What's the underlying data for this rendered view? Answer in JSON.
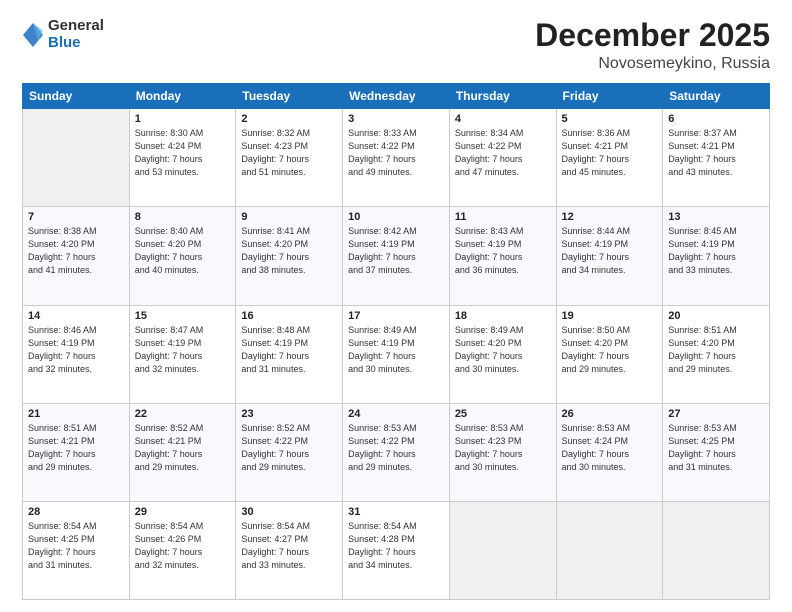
{
  "logo": {
    "general": "General",
    "blue": "Blue"
  },
  "header": {
    "title": "December 2025",
    "subtitle": "Novosemeykino, Russia"
  },
  "days_of_week": [
    "Sunday",
    "Monday",
    "Tuesday",
    "Wednesday",
    "Thursday",
    "Friday",
    "Saturday"
  ],
  "weeks": [
    [
      {
        "day": "",
        "info": ""
      },
      {
        "day": "1",
        "info": "Sunrise: 8:30 AM\nSunset: 4:24 PM\nDaylight: 7 hours\nand 53 minutes."
      },
      {
        "day": "2",
        "info": "Sunrise: 8:32 AM\nSunset: 4:23 PM\nDaylight: 7 hours\nand 51 minutes."
      },
      {
        "day": "3",
        "info": "Sunrise: 8:33 AM\nSunset: 4:22 PM\nDaylight: 7 hours\nand 49 minutes."
      },
      {
        "day": "4",
        "info": "Sunrise: 8:34 AM\nSunset: 4:22 PM\nDaylight: 7 hours\nand 47 minutes."
      },
      {
        "day": "5",
        "info": "Sunrise: 8:36 AM\nSunset: 4:21 PM\nDaylight: 7 hours\nand 45 minutes."
      },
      {
        "day": "6",
        "info": "Sunrise: 8:37 AM\nSunset: 4:21 PM\nDaylight: 7 hours\nand 43 minutes."
      }
    ],
    [
      {
        "day": "7",
        "info": "Sunrise: 8:38 AM\nSunset: 4:20 PM\nDaylight: 7 hours\nand 41 minutes."
      },
      {
        "day": "8",
        "info": "Sunrise: 8:40 AM\nSunset: 4:20 PM\nDaylight: 7 hours\nand 40 minutes."
      },
      {
        "day": "9",
        "info": "Sunrise: 8:41 AM\nSunset: 4:20 PM\nDaylight: 7 hours\nand 38 minutes."
      },
      {
        "day": "10",
        "info": "Sunrise: 8:42 AM\nSunset: 4:19 PM\nDaylight: 7 hours\nand 37 minutes."
      },
      {
        "day": "11",
        "info": "Sunrise: 8:43 AM\nSunset: 4:19 PM\nDaylight: 7 hours\nand 36 minutes."
      },
      {
        "day": "12",
        "info": "Sunrise: 8:44 AM\nSunset: 4:19 PM\nDaylight: 7 hours\nand 34 minutes."
      },
      {
        "day": "13",
        "info": "Sunrise: 8:45 AM\nSunset: 4:19 PM\nDaylight: 7 hours\nand 33 minutes."
      }
    ],
    [
      {
        "day": "14",
        "info": "Sunrise: 8:46 AM\nSunset: 4:19 PM\nDaylight: 7 hours\nand 32 minutes."
      },
      {
        "day": "15",
        "info": "Sunrise: 8:47 AM\nSunset: 4:19 PM\nDaylight: 7 hours\nand 32 minutes."
      },
      {
        "day": "16",
        "info": "Sunrise: 8:48 AM\nSunset: 4:19 PM\nDaylight: 7 hours\nand 31 minutes."
      },
      {
        "day": "17",
        "info": "Sunrise: 8:49 AM\nSunset: 4:19 PM\nDaylight: 7 hours\nand 30 minutes."
      },
      {
        "day": "18",
        "info": "Sunrise: 8:49 AM\nSunset: 4:20 PM\nDaylight: 7 hours\nand 30 minutes."
      },
      {
        "day": "19",
        "info": "Sunrise: 8:50 AM\nSunset: 4:20 PM\nDaylight: 7 hours\nand 29 minutes."
      },
      {
        "day": "20",
        "info": "Sunrise: 8:51 AM\nSunset: 4:20 PM\nDaylight: 7 hours\nand 29 minutes."
      }
    ],
    [
      {
        "day": "21",
        "info": "Sunrise: 8:51 AM\nSunset: 4:21 PM\nDaylight: 7 hours\nand 29 minutes."
      },
      {
        "day": "22",
        "info": "Sunrise: 8:52 AM\nSunset: 4:21 PM\nDaylight: 7 hours\nand 29 minutes."
      },
      {
        "day": "23",
        "info": "Sunrise: 8:52 AM\nSunset: 4:22 PM\nDaylight: 7 hours\nand 29 minutes."
      },
      {
        "day": "24",
        "info": "Sunrise: 8:53 AM\nSunset: 4:22 PM\nDaylight: 7 hours\nand 29 minutes."
      },
      {
        "day": "25",
        "info": "Sunrise: 8:53 AM\nSunset: 4:23 PM\nDaylight: 7 hours\nand 30 minutes."
      },
      {
        "day": "26",
        "info": "Sunrise: 8:53 AM\nSunset: 4:24 PM\nDaylight: 7 hours\nand 30 minutes."
      },
      {
        "day": "27",
        "info": "Sunrise: 8:53 AM\nSunset: 4:25 PM\nDaylight: 7 hours\nand 31 minutes."
      }
    ],
    [
      {
        "day": "28",
        "info": "Sunrise: 8:54 AM\nSunset: 4:25 PM\nDaylight: 7 hours\nand 31 minutes."
      },
      {
        "day": "29",
        "info": "Sunrise: 8:54 AM\nSunset: 4:26 PM\nDaylight: 7 hours\nand 32 minutes."
      },
      {
        "day": "30",
        "info": "Sunrise: 8:54 AM\nSunset: 4:27 PM\nDaylight: 7 hours\nand 33 minutes."
      },
      {
        "day": "31",
        "info": "Sunrise: 8:54 AM\nSunset: 4:28 PM\nDaylight: 7 hours\nand 34 minutes."
      },
      {
        "day": "",
        "info": ""
      },
      {
        "day": "",
        "info": ""
      },
      {
        "day": "",
        "info": ""
      }
    ]
  ]
}
